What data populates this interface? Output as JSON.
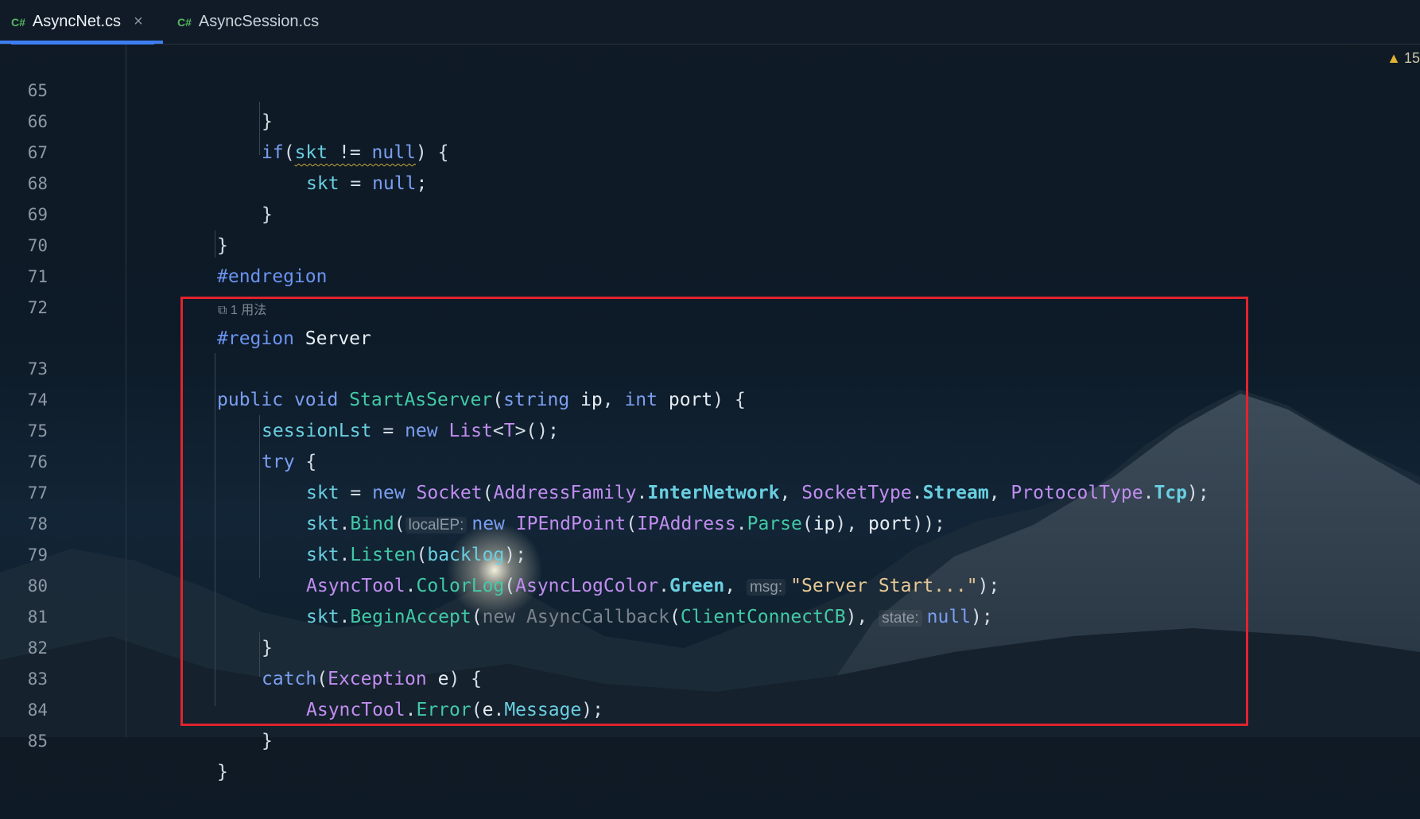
{
  "tabs": [
    {
      "lang": "C#",
      "name": "AsyncNet.cs",
      "active": true,
      "close": "×"
    },
    {
      "lang": "C#",
      "name": "AsyncSession.cs",
      "active": false
    }
  ],
  "warnings": {
    "icon": "warning-icon",
    "count": "15"
  },
  "inlay_usage": "1 用法",
  "hints": {
    "local_ep": "localEP:",
    "msg": "msg:",
    "state": "state:"
  },
  "lines": [
    "65",
    "66",
    "67",
    "68",
    "69",
    "70",
    "71",
    "72",
    "73",
    "74",
    "75",
    "76",
    "77",
    "78",
    "79",
    "80",
    "81",
    "82",
    "83",
    "84",
    "85"
  ],
  "code": {
    "l73_name": "StartAsServer",
    "l79_string": "\"Server Start...\"",
    "region_name": "Server"
  },
  "colors": {
    "highlight_border": "#e0242e",
    "active_tab_underline": "#3d7ef3"
  }
}
